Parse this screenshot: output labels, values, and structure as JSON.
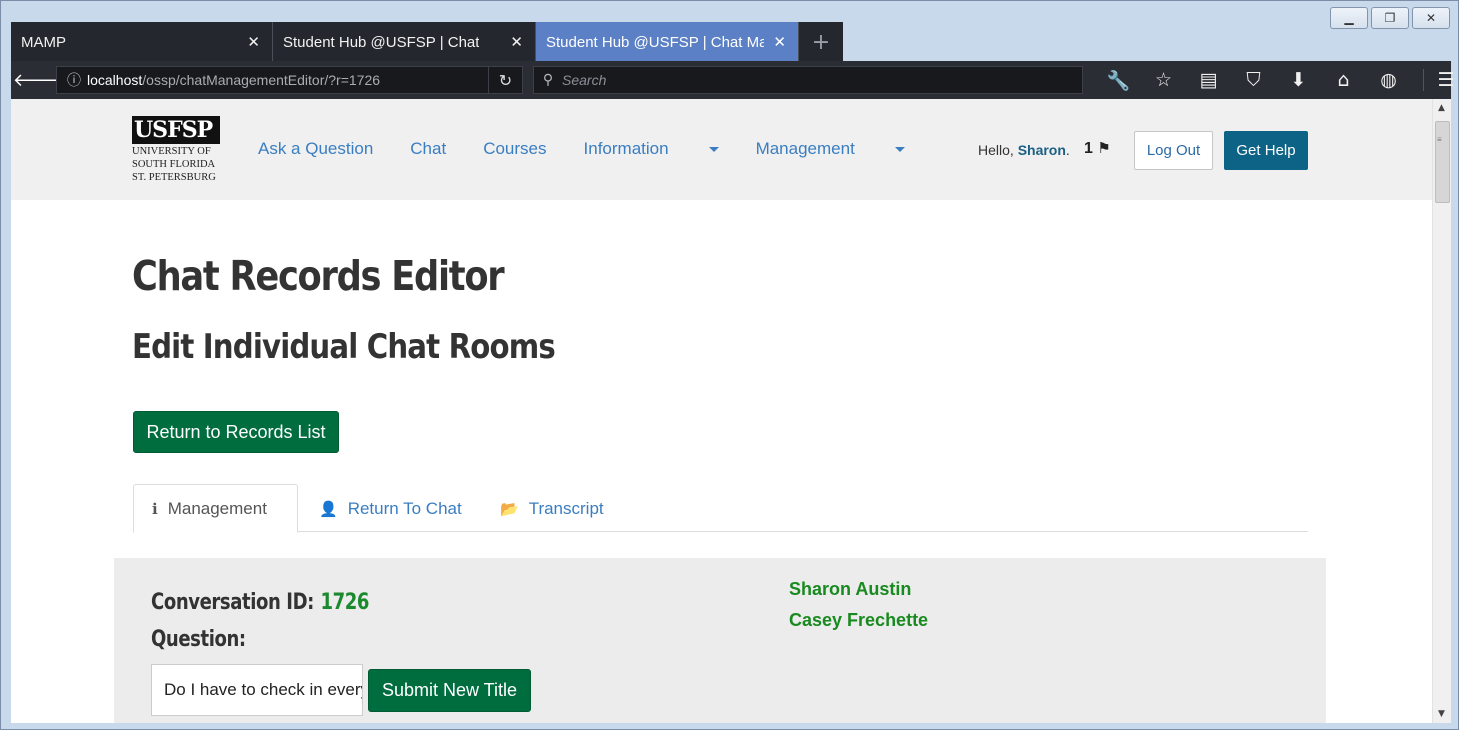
{
  "browser": {
    "tabs": [
      {
        "label": "MAMP"
      },
      {
        "label": "Student Hub @USFSP | Chat"
      },
      {
        "label": "Student Hub @USFSP | Chat Management"
      }
    ],
    "url_host": "localhost",
    "url_path": "/ossp/chatManagementEditor/?r=1726",
    "search_placeholder": "Search"
  },
  "site": {
    "logo_mark": "USFSP",
    "logo_lines": [
      "UNIVERSITY OF",
      "SOUTH FLORIDA",
      "ST. PETERSBURG"
    ],
    "nav": {
      "ask": "Ask a Question",
      "chat": "Chat",
      "courses": "Courses",
      "information": "Information",
      "management": "Management"
    },
    "greeting": "Hello,",
    "user_name": "Sharon",
    "notification_count": "1",
    "logout_label": "Log Out",
    "help_label": "Get Help"
  },
  "page": {
    "title": "Chat Records Editor",
    "subtitle": "Edit Individual Chat Rooms",
    "return_button": "Return to Records List",
    "tabs": [
      {
        "label": "Management",
        "icon": "info-icon"
      },
      {
        "label": "Return To Chat",
        "icon": "user-icon"
      },
      {
        "label": "Transcript",
        "icon": "folder-open-icon"
      }
    ],
    "conversation_label": "Conversation ID:",
    "conversation_id": "1726",
    "question_label": "Question:",
    "question_value": "Do I have to check in every day?",
    "submit_button": "Submit New Title",
    "participants": [
      "Sharon Austin",
      "Casey Frechette"
    ]
  },
  "colors": {
    "brand_green": "#006d3f",
    "id_green": "#1b8a2e",
    "participant_green": "#198a1f",
    "link_blue": "#3a7ec2",
    "help_blue": "#0d6386",
    "active_tab": "#5b80c6"
  }
}
